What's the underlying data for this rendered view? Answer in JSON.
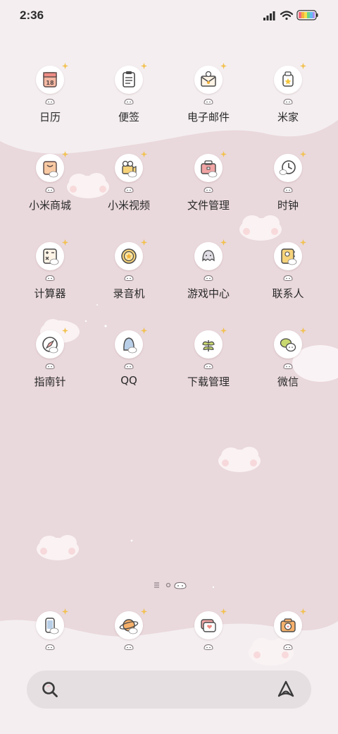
{
  "status_bar": {
    "time": "2:36",
    "icons": [
      "signal-icon",
      "wifi-icon",
      "battery-icon"
    ]
  },
  "home": {
    "apps": [
      {
        "label": "日历",
        "icon": "calendar-icon"
      },
      {
        "label": "便签",
        "icon": "notes-icon"
      },
      {
        "label": "电子邮件",
        "icon": "email-icon"
      },
      {
        "label": "米家",
        "icon": "mijia-icon"
      },
      {
        "label": "小米商城",
        "icon": "mi-store-icon"
      },
      {
        "label": "小米视频",
        "icon": "video-camera-icon"
      },
      {
        "label": "文件管理",
        "icon": "file-manager-icon"
      },
      {
        "label": "时钟",
        "icon": "clock-icon"
      },
      {
        "label": "计算器",
        "icon": "calculator-icon"
      },
      {
        "label": "录音机",
        "icon": "recorder-icon"
      },
      {
        "label": "游戏中心",
        "icon": "game-center-icon"
      },
      {
        "label": "联系人",
        "icon": "contacts-icon"
      },
      {
        "label": "指南针",
        "icon": "compass-icon"
      },
      {
        "label": "QQ",
        "icon": "qq-icon"
      },
      {
        "label": "下载管理",
        "icon": "download-manager-icon"
      },
      {
        "label": "微信",
        "icon": "wechat-icon"
      }
    ]
  },
  "page_indicator": {
    "current_page": 2,
    "pages": 3
  },
  "dock": {
    "apps": [
      {
        "icon": "phone-icon"
      },
      {
        "icon": "browser-planet-icon"
      },
      {
        "icon": "messages-icon"
      },
      {
        "icon": "camera-icon"
      }
    ]
  },
  "search": {
    "placeholder": "",
    "left_icon": "search-icon",
    "right_icon": "assistant-icon"
  },
  "colors": {
    "wallpaper_top": "#f3edee",
    "wallpaper_bottom": "#e6d4d8",
    "search_bar": "#e6dfe2",
    "label_text": "#2a2a2a"
  }
}
